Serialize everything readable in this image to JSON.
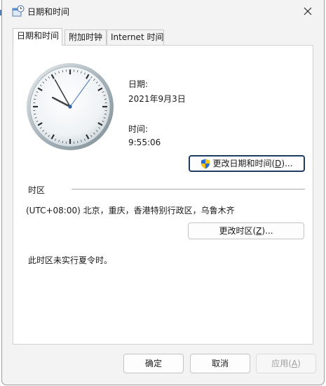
{
  "window": {
    "title": "日期和时间",
    "close_icon": "close-icon",
    "app_icon": "date-time-control-panel-icon"
  },
  "tabs": [
    {
      "label": "日期和时间",
      "active": true
    },
    {
      "label": "附加时钟",
      "active": false
    },
    {
      "label": "Internet 时间",
      "active": false
    }
  ],
  "datetime": {
    "date_label": "日期:",
    "date_value": "2021年9月3日",
    "time_label": "时间:",
    "time_value": "9:55:06",
    "change_button": {
      "label": "更改日期和时间(",
      "accel": "D",
      "suffix": ")...",
      "icon": "uac-shield-icon"
    }
  },
  "timezone": {
    "section_label": "时区",
    "value": "(UTC+08:00) 北京，重庆，香港特别行政区，乌鲁木齐",
    "change_button": {
      "label": "更改时区(",
      "accel": "Z",
      "suffix": ")..."
    },
    "dst_note": "此时区未实行夏令时。"
  },
  "footer": {
    "ok": "确定",
    "cancel": "取消",
    "apply": {
      "label": "应用(",
      "accel": "A",
      "suffix": ")"
    }
  },
  "clock": {
    "hours": 9,
    "minutes": 55,
    "seconds": 6
  }
}
